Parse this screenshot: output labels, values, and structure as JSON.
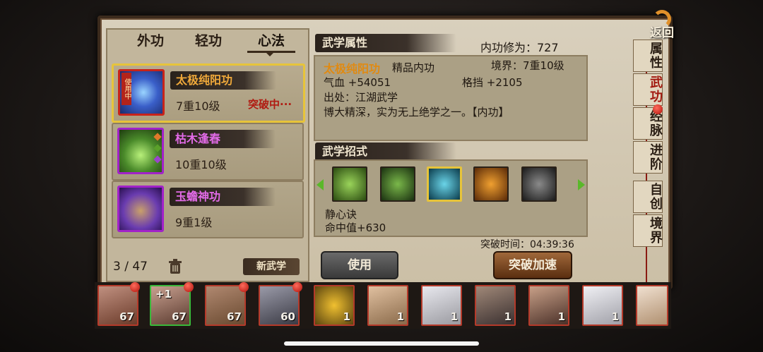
{
  "tabs": [
    {
      "label": "外功"
    },
    {
      "label": "轻功"
    },
    {
      "label": "心法"
    }
  ],
  "skills": [
    {
      "name": "太极纯阳功",
      "level": "7重10级",
      "status": "突破中···",
      "badge": "使用中",
      "name_color": "#f0a93a",
      "icon_color": "#3a5fc9"
    },
    {
      "name": "枯木逢春",
      "level": "10重10级",
      "name_color": "#e36be8",
      "icon_color": "#4a8a2a"
    },
    {
      "name": "玉蟾神功",
      "level": "9重1级",
      "name_color": "#e36be8",
      "icon_color": "#6a3cb0"
    }
  ],
  "list_footer": {
    "count": "3 / 47",
    "new_label": "新武学"
  },
  "attrs": {
    "title": "武学属性",
    "cultivation": "内功修为：727",
    "skill_name": "太极纯阳功",
    "skill_type": "精品内功",
    "realm": "境界：7重10级",
    "hp": "气血 +54051",
    "block": "格挡 +2105",
    "source": "出处：江湖武学",
    "desc": "博大精深，实为无上绝学之一。【内功】"
  },
  "moves": {
    "title": "武学招式",
    "icons": [
      "sprout-icon",
      "kneeling-figure-icon",
      "water-dragon-icon",
      "flaming-warrior-icon",
      "meditating-figure-icon"
    ],
    "selected_name": "静心诀",
    "selected_effect": "命中值+630"
  },
  "breakthrough_time": "突破时间：04:39:36",
  "buttons": {
    "use": "使用",
    "speedup": "突破加速"
  },
  "nav": [
    {
      "label": "属性"
    },
    {
      "label": "武功"
    },
    {
      "label": "经脉"
    },
    {
      "label": "进阶"
    },
    {
      "label": "自创"
    },
    {
      "label": "境界"
    }
  ],
  "back_label": "返回",
  "heroes": [
    {
      "count": "67",
      "color": "#6b3b2a"
    },
    {
      "count": "67",
      "plus": "+1",
      "color": "#5a3a2e"
    },
    {
      "count": "67",
      "color": "#6a4a30"
    },
    {
      "count": "60",
      "color": "#3a3a44"
    },
    {
      "count": "1",
      "color": "#5a4410"
    },
    {
      "count": "1",
      "color": "#8a6a4a"
    },
    {
      "count": "1",
      "color": "#9a9aa0"
    },
    {
      "count": "1",
      "color": "#3a3030"
    },
    {
      "count": "1",
      "color": "#4a3028"
    },
    {
      "count": "1",
      "color": "#a0a0a8"
    },
    {
      "count": "",
      "color": "#b09070"
    }
  ]
}
